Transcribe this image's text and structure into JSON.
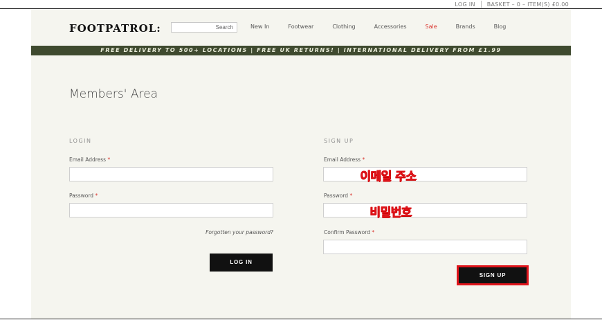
{
  "topbar": {
    "login": "LOG IN",
    "basket": "BASKET – 0 – ITEM(S) £0.00"
  },
  "header": {
    "logo": "FOOTPATROL:",
    "search_placeholder": "Search",
    "nav": [
      "New In",
      "Footwear",
      "Clothing",
      "Accessories",
      "Sale",
      "Brands",
      "Blog"
    ]
  },
  "banner": "FREE DELIVERY TO 500+ LOCATIONS | FREE UK RETURNS! | INTERNATIONAL DELIVERY FROM £1.99",
  "page_title": "Members' Area",
  "login": {
    "heading": "LOGIN",
    "email_label": "Email Address",
    "password_label": "Password",
    "required_marker": "*",
    "forgot": "Forgotten your password?",
    "button": "LOG IN"
  },
  "signup": {
    "heading": "SIGN UP",
    "email_label": "Email Address",
    "password_label": "Password",
    "confirm_label": "Confirm Password",
    "required_marker": "*",
    "button": "SIGN UP"
  },
  "annotations": {
    "email": "이메일 주소",
    "password": "비밀번호",
    "highlight_color": "#e0141b"
  },
  "colors": {
    "banner_bg": "#3f4a2f",
    "page_bg": "#f5f5ef",
    "sale": "#d9322b",
    "button": "#111111"
  }
}
